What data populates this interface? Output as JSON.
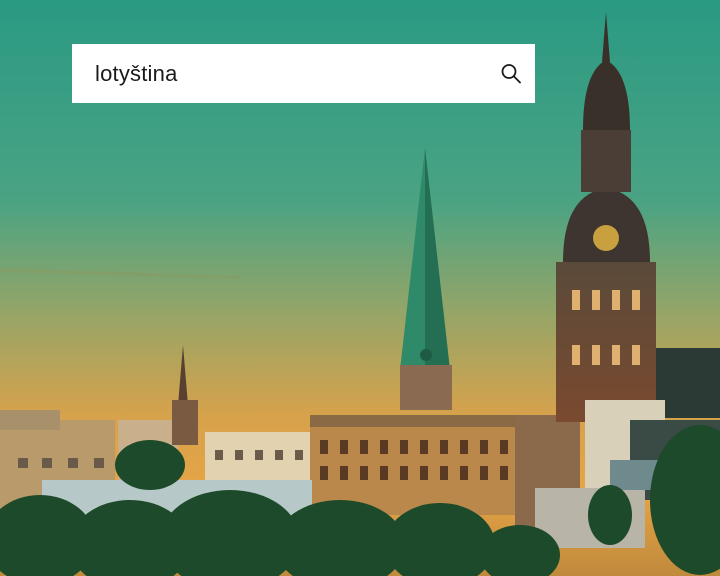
{
  "search": {
    "value": "lotyština"
  },
  "background": {
    "subject": "riga-skyline-sunset",
    "colors": {
      "sky_top": "#2e9b82",
      "sky_mid": "#9aa66a",
      "sky_low": "#e0a24d",
      "buildings": "#6b4a35",
      "spire": "#2f8a6a",
      "trees": "#1d4a2a"
    }
  },
  "icons": {
    "search": "search-icon"
  }
}
